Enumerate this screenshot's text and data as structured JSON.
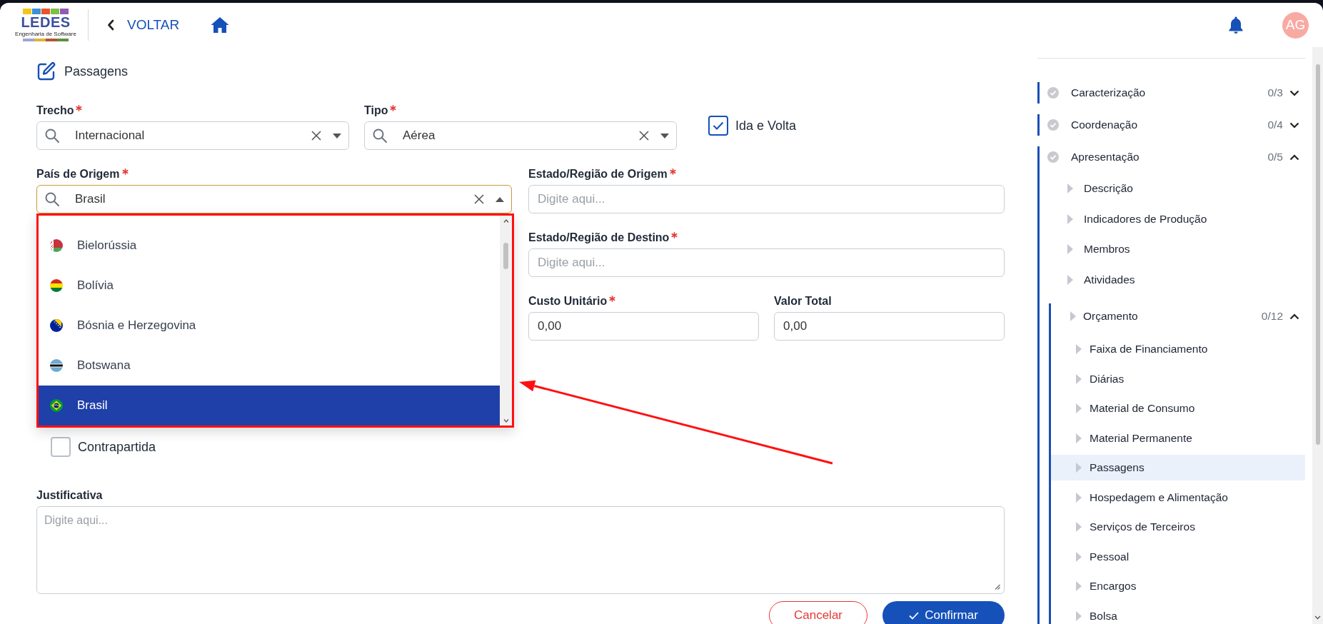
{
  "header": {
    "logo_title": "LEDES",
    "logo_subtitle": "Engenharia de Software",
    "back_label": "VOLTAR",
    "avatar_initials": "AG"
  },
  "page": {
    "title": "Passagens"
  },
  "form": {
    "top_row": [
      {
        "kind": "select",
        "label": "Trecho",
        "required": true,
        "value": "Internacional",
        "expanded": false
      },
      {
        "kind": "select",
        "label": "Tipo",
        "required": true,
        "value": "Aérea",
        "expanded": false
      },
      {
        "kind": "checkbox",
        "label": "Ida e Volta",
        "checked": true
      }
    ],
    "origin_country": {
      "label": "País de Origem",
      "required": true,
      "value": "Brasil",
      "expanded": true,
      "options": [
        {
          "name": "Bielorússia",
          "selected": false
        },
        {
          "name": "Bolívia",
          "selected": false
        },
        {
          "name": "Bósnia e Herzegovina",
          "selected": false
        },
        {
          "name": "Botswana",
          "selected": false
        },
        {
          "name": "Brasil",
          "selected": true
        }
      ]
    },
    "right_fields": [
      {
        "label": "Estado/Região de Origem",
        "required": true,
        "placeholder": "Digite aqui..."
      },
      {
        "label": "Estado/Região de Destino",
        "required": true,
        "placeholder": "Digite aqui..."
      }
    ],
    "amount_fields": [
      {
        "label": "Custo Unitário",
        "required": true,
        "value": "0,00"
      },
      {
        "label": "Valor Total",
        "required": false,
        "value": "0,00"
      }
    ],
    "counterpart": {
      "label": "Contrapartida",
      "checked": false
    },
    "justification": {
      "label": "Justificativa",
      "required": false,
      "placeholder": "Digite aqui..."
    }
  },
  "actions": [
    {
      "kind": "cancel",
      "label": "Cancelar"
    },
    {
      "kind": "confirm",
      "label": "Confirmar"
    }
  ],
  "sidebar": {
    "sections": [
      {
        "label": "Caracterização",
        "count": "0/3",
        "expanded": false,
        "selected": false
      },
      {
        "label": "Coordenação",
        "count": "0/4",
        "expanded": false,
        "selected": false
      },
      {
        "label": "Apresentação",
        "count": "0/5",
        "expanded": true,
        "selected": false,
        "children": [
          {
            "label": "Descrição",
            "selected": false
          },
          {
            "label": "Indicadores de Produção",
            "selected": false
          },
          {
            "label": "Membros",
            "selected": false
          },
          {
            "label": "Atividades",
            "selected": false
          },
          {
            "label": "Orçamento",
            "count": "0/12",
            "expanded": true,
            "selected": false,
            "children": [
              {
                "label": "Faixa de Financiamento",
                "selected": false
              },
              {
                "label": "Diárias",
                "selected": false
              },
              {
                "label": "Material de Consumo",
                "selected": false
              },
              {
                "label": "Material Permanente",
                "selected": false
              },
              {
                "label": "Passagens",
                "selected": true
              },
              {
                "label": "Hospedagem e Alimentação",
                "selected": false
              },
              {
                "label": "Serviços de Terceiros",
                "selected": false
              },
              {
                "label": "Pessoal",
                "selected": false
              },
              {
                "label": "Encargos",
                "selected": false
              },
              {
                "label": "Bolsa",
                "selected": false
              }
            ]
          }
        ]
      }
    ]
  }
}
